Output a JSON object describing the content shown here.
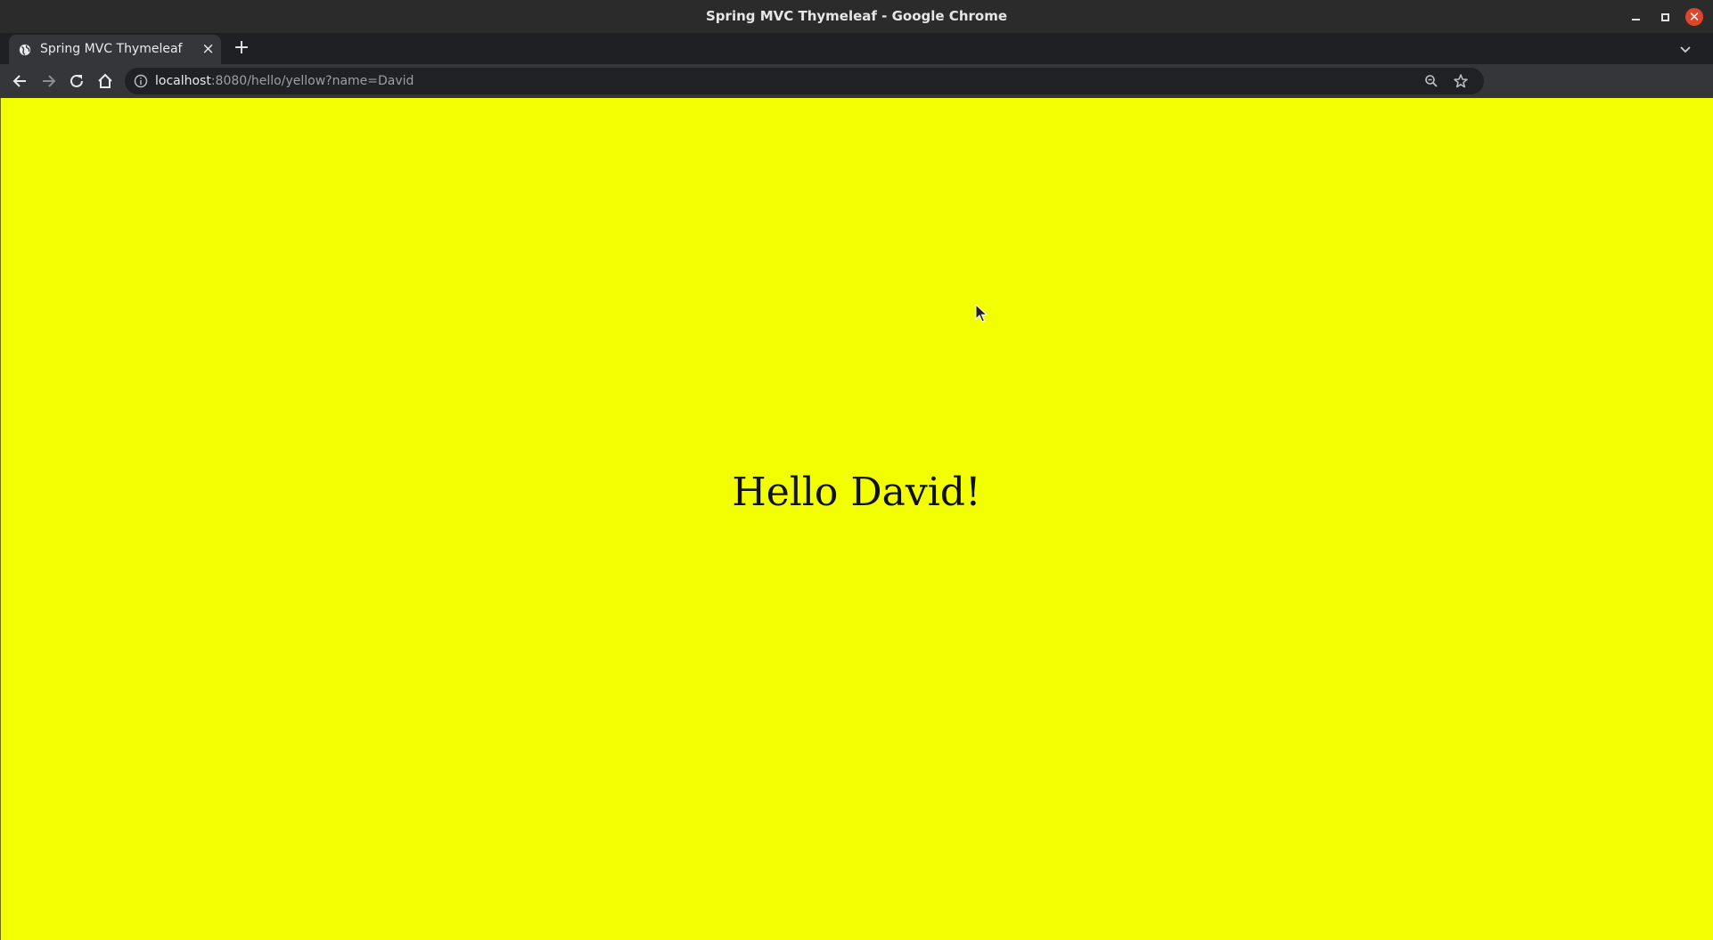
{
  "window": {
    "title": "Spring MVC Thymeleaf - Google Chrome",
    "close_glyph": "✕"
  },
  "tabs": [
    {
      "title": "Spring MVC Thymeleaf",
      "active": true,
      "favicon": "globe-icon"
    }
  ],
  "tab_controls": {
    "close_glyph": "×",
    "new_tab_glyph": "+"
  },
  "address_bar": {
    "host": "localhost",
    "rest": ":8080/hello/yellow?name=David",
    "icons": [
      "info-icon",
      "zoom-icon",
      "star-icon"
    ]
  },
  "page": {
    "background_color": "#f2ff00",
    "heading": "Hello David!"
  }
}
